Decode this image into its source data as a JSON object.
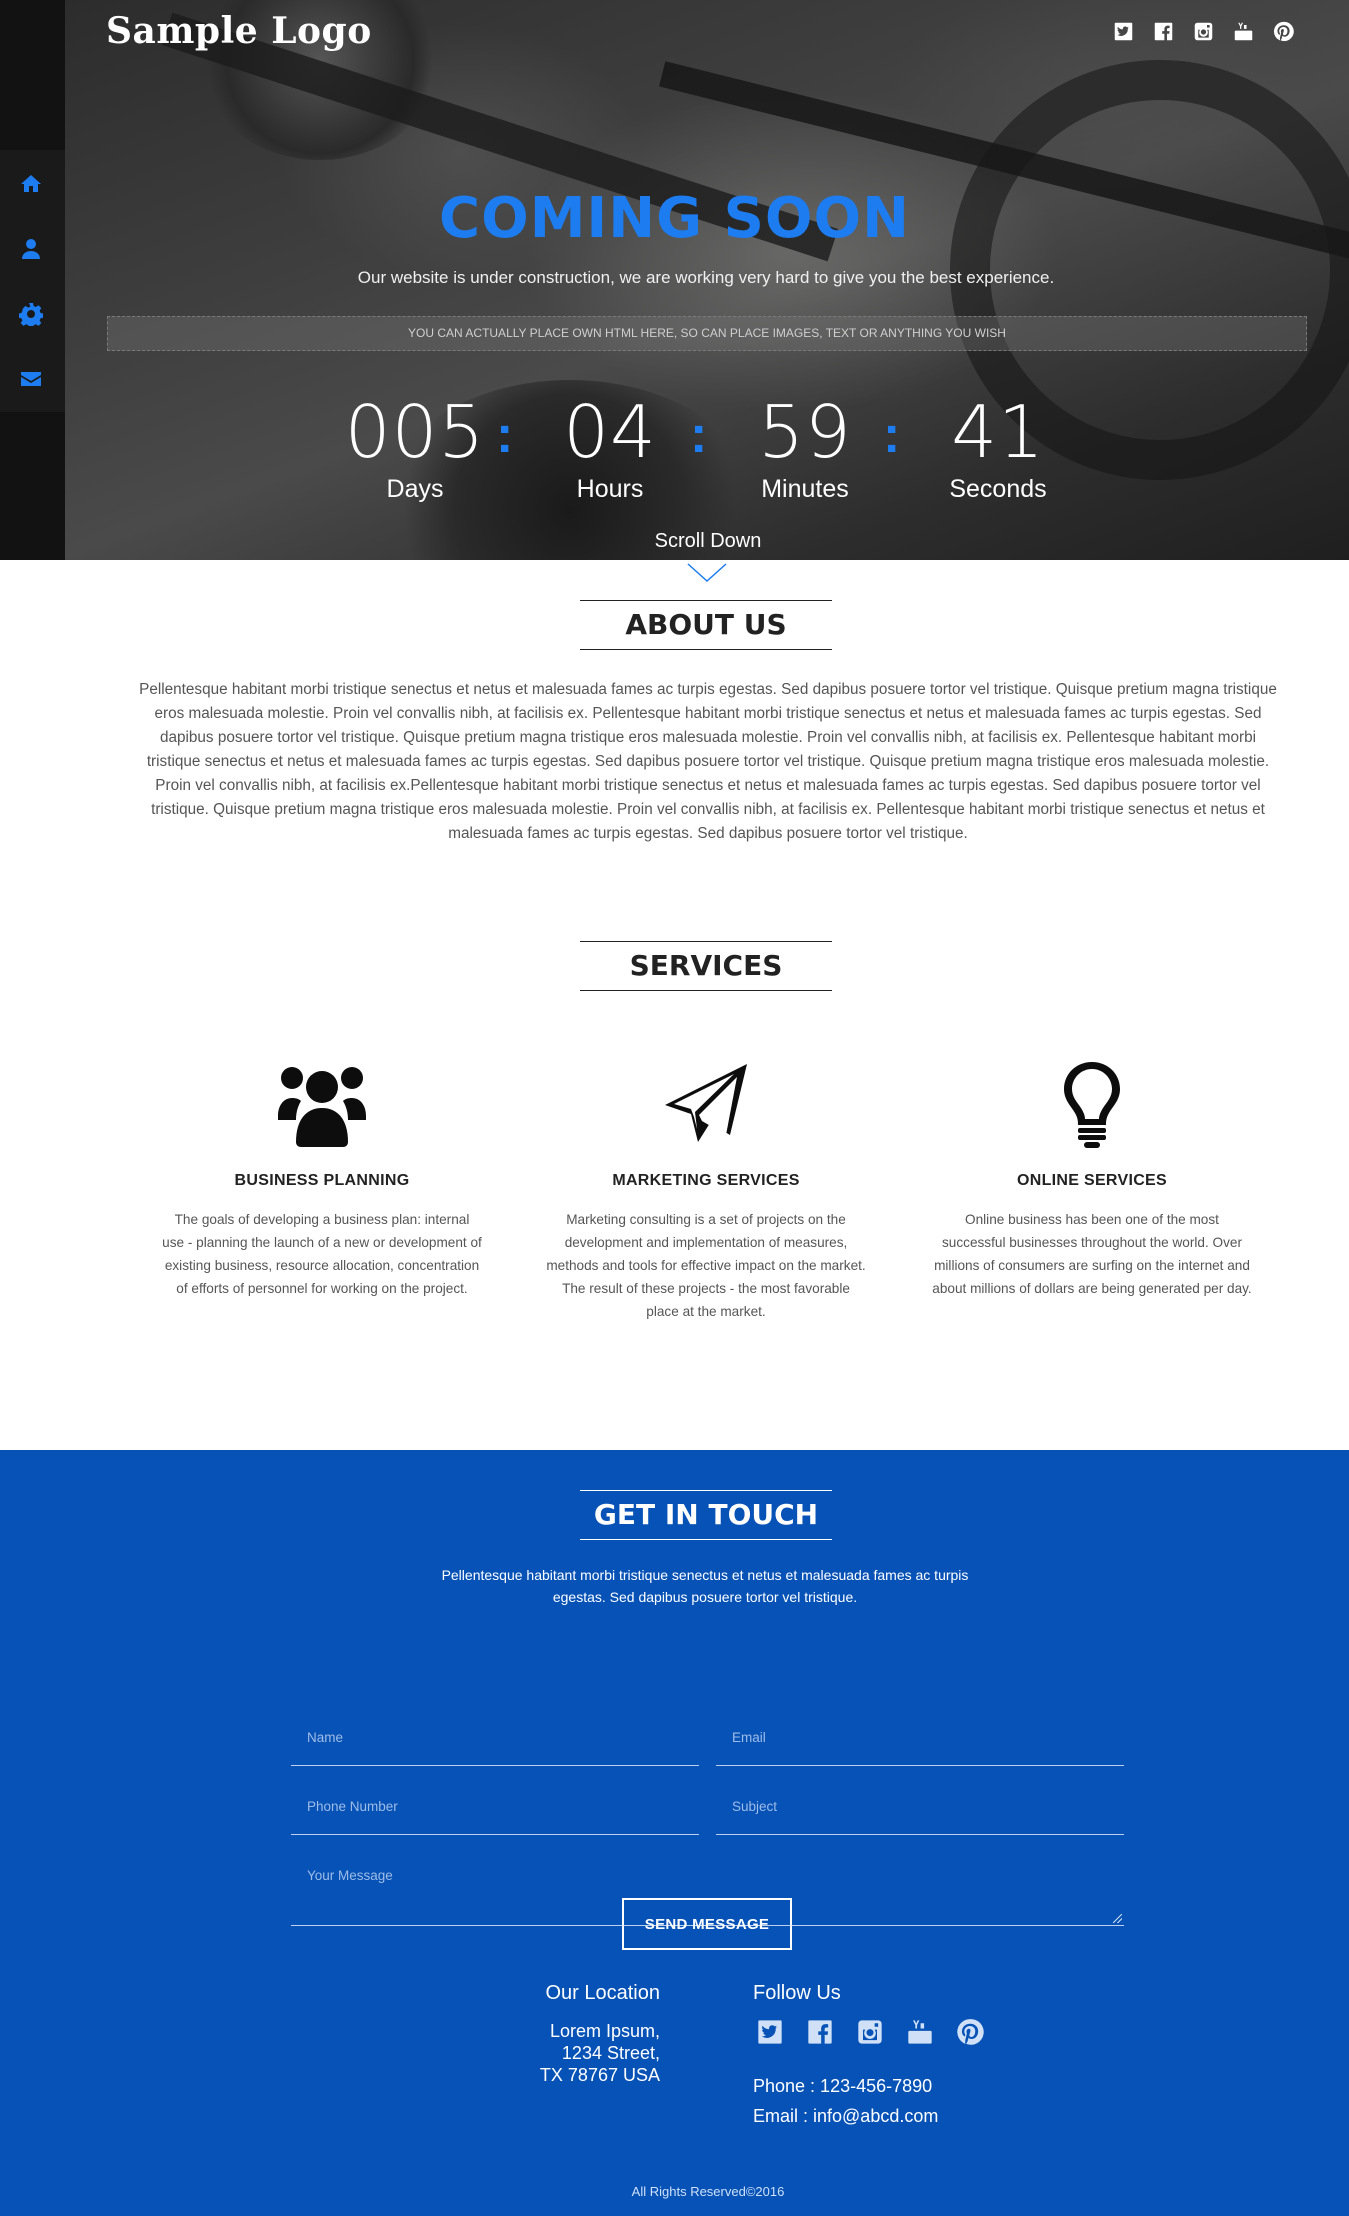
{
  "brand": {
    "logo_text": "Sample Logo",
    "accent_color": "#1c7cf0",
    "contact_bg_color": "#0652b7"
  },
  "social_icons": [
    "twitter-icon",
    "facebook-icon",
    "instagram-icon",
    "youtube-icon",
    "pinterest-icon"
  ],
  "sidebar": {
    "items": [
      {
        "icon": "home-icon"
      },
      {
        "icon": "user-icon"
      },
      {
        "icon": "gear-icon"
      },
      {
        "icon": "envelope-icon"
      }
    ]
  },
  "hero": {
    "title": "COMING SOON",
    "tagline": "Our website is under construction, we are working very hard to give you the best experience.",
    "html_note": "YOU CAN ACTUALLY PLACE OWN HTML HERE, SO CAN PLACE IMAGES, TEXT OR ANYTHING YOU WISH",
    "countdown": {
      "days": {
        "value": "005",
        "label": "Days"
      },
      "hours": {
        "value": "04",
        "label": "Hours"
      },
      "minutes": {
        "value": "59",
        "label": "Minutes"
      },
      "seconds": {
        "value": "41",
        "label": "Seconds"
      },
      "separator": ":"
    },
    "scroll_label": "Scroll Down"
  },
  "about": {
    "title": "ABOUT US",
    "text": "Pellentesque habitant morbi tristique senectus et netus et malesuada fames ac turpis egestas. Sed dapibus posuere tortor vel tristique. Quisque pretium magna tristique eros malesuada molestie. Proin vel convallis nibh, at facilisis ex. Pellentesque habitant morbi tristique senectus et netus et malesuada fames ac turpis egestas. Sed dapibus posuere tortor vel tristique. Quisque pretium magna tristique eros malesuada molestie. Proin vel convallis nibh, at facilisis ex. Pellentesque habitant morbi tristique senectus et netus et malesuada fames ac turpis egestas. Sed dapibus posuere tortor vel tristique. Quisque pretium magna tristique eros malesuada molestie. Proin vel convallis nibh, at facilisis ex.Pellentesque habitant morbi tristique senectus et netus et malesuada fames ac turpis egestas. Sed dapibus posuere tortor vel tristique. Quisque pretium magna tristique eros malesuada molestie. Proin vel convallis nibh, at facilisis ex. Pellentesque habitant morbi tristique senectus et netus et malesuada fames ac turpis egestas. Sed dapibus posuere tortor vel tristique."
  },
  "services": {
    "title": "SERVICES",
    "items": [
      {
        "icon": "users-icon",
        "title": "BUSINESS PLANNING",
        "text": "The goals of developing a business plan: internal use - planning the launch of a new or development of existing business, resource allocation, concentration of efforts of personnel for working on the project."
      },
      {
        "icon": "paper-plane-icon",
        "title": "MARKETING SERVICES",
        "text": "Marketing consulting is a set of projects on the development and implementation of measures, methods and tools for effective impact on the market. The result of these projects - the most favorable place at the market."
      },
      {
        "icon": "lightbulb-icon",
        "title": "ONLINE SERVICES",
        "text": "Online business has been one of the most successful businesses throughout the world. Over millions of consumers are surfing on the internet and about millions of dollars are being generated per day."
      }
    ]
  },
  "contact": {
    "title": "GET IN TOUCH",
    "description": "Pellentesque habitant morbi tristique senectus et netus et malesuada fames ac turpis egestas. Sed dapibus posuere tortor vel tristique.",
    "fields": {
      "name": "Name",
      "email": "Email",
      "phone": "Phone Number",
      "subject": "Subject",
      "message": "Your Message"
    },
    "send_label": "SEND MESSAGE",
    "location_title": "Our Location",
    "address_line1": "Lorem Ipsum,",
    "address_line2": "1234 Street,",
    "address_line3": "TX 78767 USA",
    "follow_title": "Follow Us",
    "phone": "Phone : 123-456-7890",
    "email": "Email : info@abcd.com",
    "copyright": "All Rights Reserved©2016"
  }
}
